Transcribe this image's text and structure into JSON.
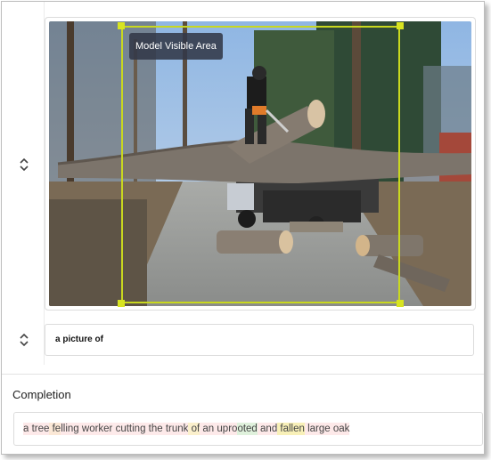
{
  "image_panel": {
    "overlay_label": "Model Visible Area"
  },
  "prompt": {
    "text": "a picture of"
  },
  "completion": {
    "heading": "Completion",
    "tokens": [
      {
        "text": "a",
        "bg": "#fde9e9"
      },
      {
        "text": " tree",
        "bg": "#fde9e9"
      },
      {
        "text": " fe",
        "bg": "#fbe8d6"
      },
      {
        "text": "lling",
        "bg": "#fde9e9"
      },
      {
        "text": " worker",
        "bg": "#fde9e9"
      },
      {
        "text": " cutting",
        "bg": "#fdeaea"
      },
      {
        "text": " the",
        "bg": "#fdeaea"
      },
      {
        "text": " trunk",
        "bg": "#fde9e9"
      },
      {
        "text": " of",
        "bg": "#fbf0cc"
      },
      {
        "text": " an",
        "bg": "#fde9e9"
      },
      {
        "text": " upro",
        "bg": "#fde9e9"
      },
      {
        "text": "oted",
        "bg": "#dff1dc"
      },
      {
        "text": " and",
        "bg": "#fde9e9"
      },
      {
        "text": " fallen",
        "bg": "#f8f0b8"
      },
      {
        "text": " large",
        "bg": "#fde9e9"
      },
      {
        "text": " oak",
        "bg": "#fde9e9"
      }
    ]
  },
  "icons": {
    "image_stepper": "chevron-up-down-icon",
    "prompt_stepper": "chevron-up-down-icon"
  },
  "colors": {
    "visible_area_border": "#c9d81f",
    "overlay_label_bg": "#323848"
  }
}
